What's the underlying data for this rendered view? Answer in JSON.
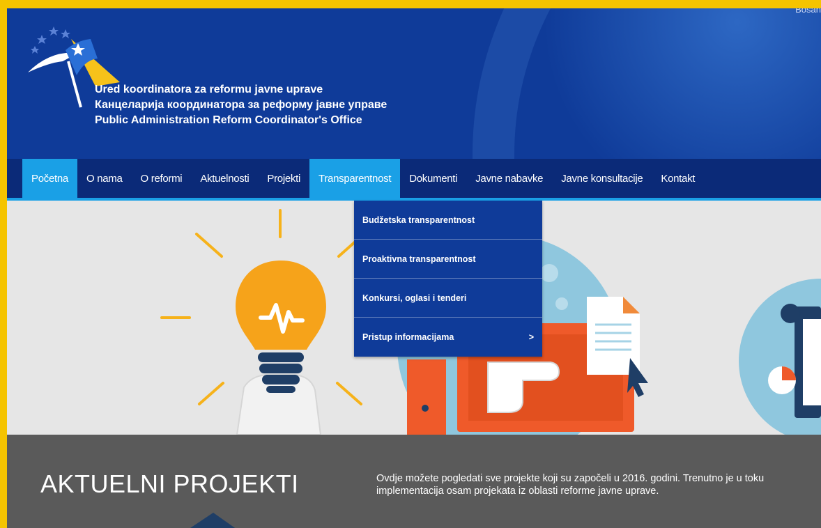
{
  "header": {
    "topright_text": "Bosan",
    "titles": [
      "Ured koordinatora za reformu javne uprave",
      "Канцеларија координатора за реформу јавне управе",
      "Public Administration Reform Coordinator's Office"
    ]
  },
  "nav": {
    "items": [
      {
        "label": "Početna"
      },
      {
        "label": "O nama"
      },
      {
        "label": "O reformi"
      },
      {
        "label": "Aktuelnosti"
      },
      {
        "label": "Projekti"
      },
      {
        "label": "Transparentnost"
      },
      {
        "label": "Dokumenti"
      },
      {
        "label": "Javne nabavke"
      },
      {
        "label": "Javne konsultacije"
      },
      {
        "label": "Kontakt"
      }
    ]
  },
  "dropdown": {
    "items": [
      {
        "label": "Budžetska transparentnost"
      },
      {
        "label": "Proaktivna transparentnost"
      },
      {
        "label": "Konkursi, oglasi i tenderi"
      },
      {
        "label": "Pristup informacijama",
        "arrow": ">"
      }
    ]
  },
  "banner": {
    "heading": "AKTUELNI PROJEKTI",
    "description": "Ovdje možete pogledati sve projekte koji su započeli u 2016. godini. Trenutno je u toku implementacija osam projekata iz oblasti reforme javne uprave."
  },
  "colors": {
    "header_blue": "#0f3b99",
    "nav_blue": "#0b2a78",
    "accent_cyan": "#1aa0e6",
    "frame_yellow": "#f5c400",
    "banner_gray": "#5a5a5a"
  }
}
